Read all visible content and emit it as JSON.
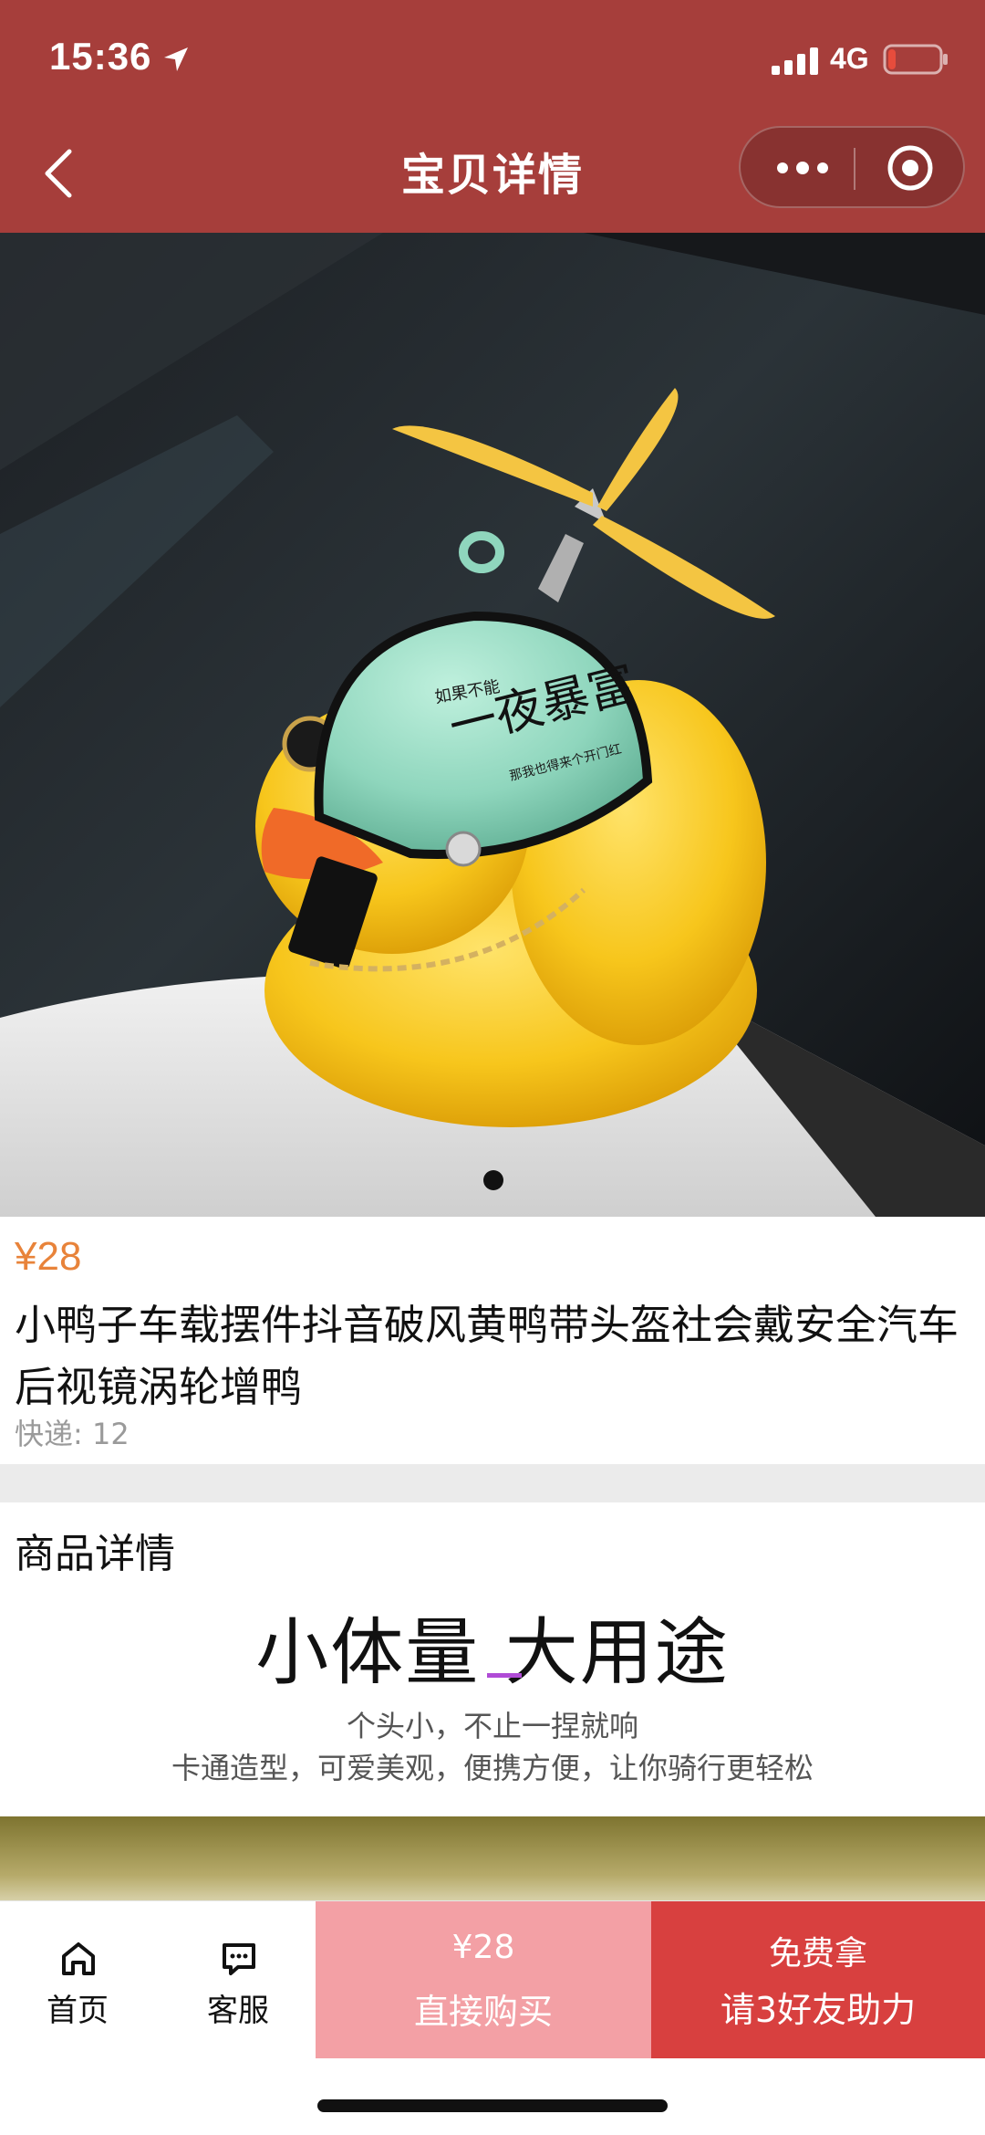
{
  "status_bar": {
    "time": "15:36",
    "network": "4G",
    "battery_level": 0.15,
    "battery_color": "#e74c3c"
  },
  "header": {
    "title": "宝贝详情",
    "background": "#a63e3b",
    "back_icon": "chevron-left-icon",
    "more_icon": "more-dots-icon",
    "close_icon": "target-circle-icon"
  },
  "product": {
    "image_helmet_line1": "如果不能",
    "image_helmet_line2": "一夜暴富",
    "image_helmet_line3": "那我也得来个开门红",
    "carousel_total": 1,
    "carousel_active": 1,
    "price": "¥28",
    "price_color": "#e8833a",
    "title": "小鸭子车载摆件抖音破风黄鸭带头盔社会戴安全汽车后视镜涡轮增鸭",
    "shipping": "快递: 12"
  },
  "details": {
    "section_title": "商品详情",
    "tagline": "小体量 大用途",
    "subtitle_1": "个头小，不止一捏就响",
    "subtitle_2": "卡通造型，可爱美观，便携方便，让你骑行更轻松"
  },
  "bottom_bar": {
    "home_label": "首页",
    "home_icon": "home-icon",
    "service_label": "客服",
    "service_icon": "chat-bubble-icon",
    "buy_price": "¥28",
    "buy_label": "直接购买",
    "buy_color": "#f3a0a5",
    "free_label_1": "免费拿",
    "free_label_2": "请3好友助力",
    "free_color": "#d8403f"
  }
}
